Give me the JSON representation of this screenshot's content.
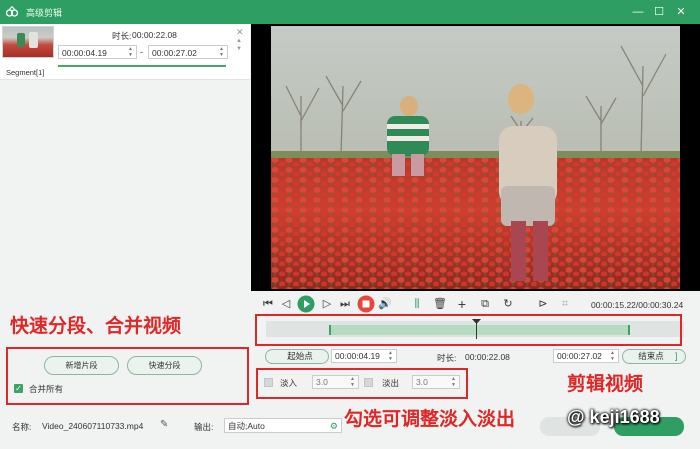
{
  "window": {
    "title": "高级剪辑",
    "controls": {
      "minimize": "—",
      "maximize": "☐",
      "close": "✕"
    },
    "accent_color": "#2f9e63"
  },
  "segment": {
    "duration_label": "时长:",
    "duration_value": "00:00:22.08",
    "start_time": "00:00:04.19",
    "end_time": "00:00:27.02",
    "separator": "-",
    "label": "Segment[1]"
  },
  "left_actions": {
    "new_clip_button": "新增片段",
    "quick_split_button": "快速分段",
    "merge_all_label": "合并所有",
    "merge_all_checked": true
  },
  "player": {
    "time_display": "00:00:15.22/00:00:30.24",
    "icons": [
      "prev-frame-icon",
      "step-back-icon",
      "play-icon",
      "step-forward-icon",
      "next-frame-icon",
      "stop-icon",
      "volume-icon",
      "split-icon",
      "delete-icon",
      "add-icon",
      "copy-icon",
      "reset-icon",
      "mark-in-icon",
      "snapshot-icon"
    ],
    "playhead_fraction": 0.503
  },
  "trim": {
    "start_bracket": "[",
    "start_point_button": "起始点",
    "start_time": "00:00:04.19",
    "duration_label": "时长:",
    "duration_value": "00:00:22.08",
    "end_time": "00:00:27.02",
    "end_point_button": "结束点",
    "end_bracket": "]"
  },
  "fade": {
    "fade_in_label": "淡入",
    "fade_in_value": "3.0",
    "fade_out_label": "淡出",
    "fade_out_value": "3.0"
  },
  "output": {
    "name_label": "名称:",
    "file_name": "Video_240607110733.mp4",
    "output_label": "输出:",
    "output_value": "自动;Auto"
  },
  "annotations": {
    "left_caption": "快速分段、合并视频",
    "right_caption": "剪辑视频",
    "bottom_caption": "勾选可调整淡入淡出",
    "color": "#e02727"
  },
  "watermark": "@ keji1688"
}
